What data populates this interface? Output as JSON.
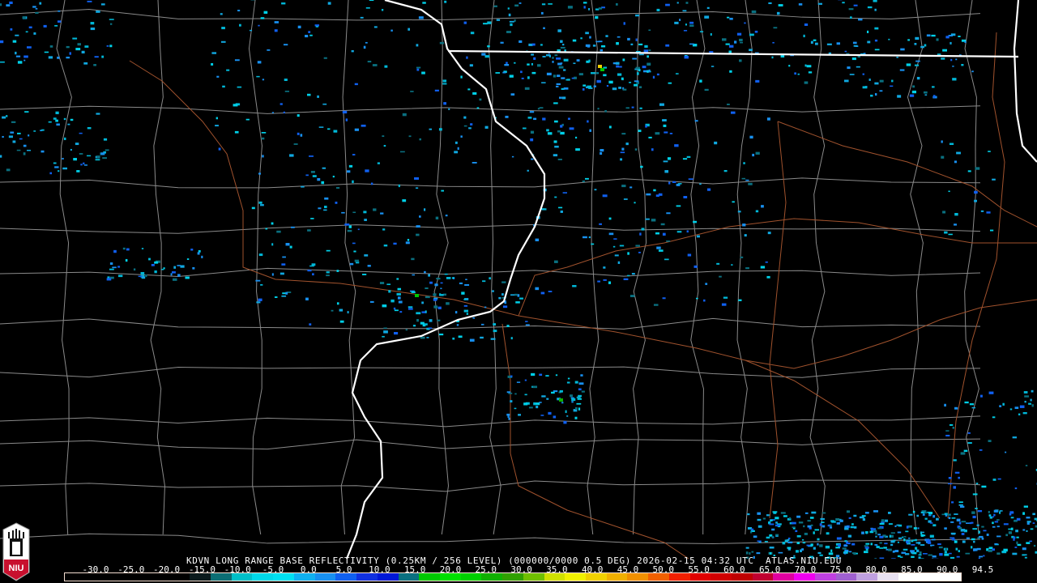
{
  "product": {
    "caption": "KDVN LONG RANGE BASE REFLECTIVITY (0.25KM / 256 LEVEL) (000000/0000 0.5 DEG) 2026-02-15 04:32 UTC  ATLAS.NIU.EDU",
    "station": "KDVN",
    "valid_time": "2026-02-15 04:32 UTC",
    "source": "ATLAS.NIU.EDU"
  },
  "colorbar": {
    "labels": [
      "-30.0",
      "-25.0",
      "-20.0",
      "-15.0",
      "-10.0",
      "-5.0",
      "0.0",
      "5.0",
      "10.0",
      "15.0",
      "20.0",
      "25.0",
      "30.0",
      "35.0",
      "40.0",
      "45.0",
      "50.0",
      "55.0",
      "60.0",
      "65.0",
      "70.0",
      "75.0",
      "80.0",
      "85.0",
      "90.0",
      "94.5"
    ],
    "colors": [
      "#000000",
      "#000000",
      "#000000",
      "#000000",
      "#000000",
      "#000000",
      "#0a1a1c",
      "#0b6e74",
      "#00c0c8",
      "#00d8e8",
      "#00e0f0",
      "#10b0f0",
      "#1890f0",
      "#1060f0",
      "#1030e0",
      "#0018d8",
      "#0a7080",
      "#00c800",
      "#00e000",
      "#00d000",
      "#10b000",
      "#30a000",
      "#70c000",
      "#d0e000",
      "#f0f000",
      "#f0d000",
      "#f0b000",
      "#f09000",
      "#f06000",
      "#f02000",
      "#e00000",
      "#d00000",
      "#c00000",
      "#c00030",
      "#e000a0",
      "#f000f0",
      "#c040e0",
      "#a060d0",
      "#c0a0e0",
      "#e8e0f0",
      "#ffffff",
      "#ffffff",
      "#ffffff"
    ]
  },
  "logo": {
    "text": "NIU"
  }
}
